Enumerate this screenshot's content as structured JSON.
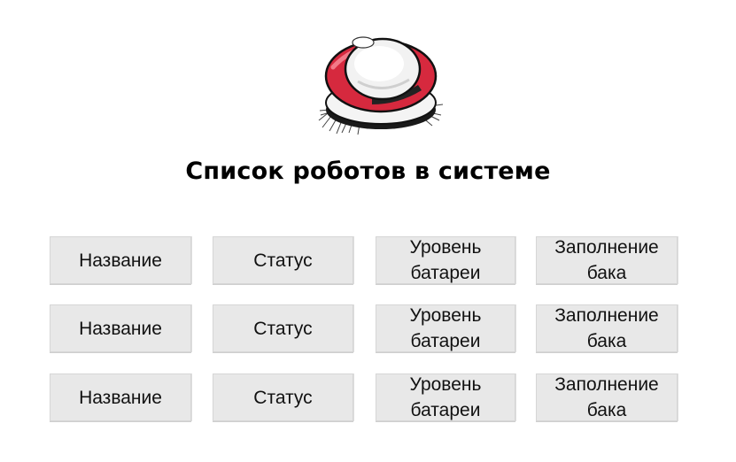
{
  "page": {
    "title": "Список роботов в системе"
  },
  "colors": {
    "cell_background": "#e8e8e8",
    "robot_accent": "#d6293e"
  },
  "logo": {
    "icon": "robot-vacuum-icon"
  },
  "robots": [
    {
      "name": "Название",
      "status": "Статус",
      "battery_line1": "Уровень",
      "battery_line2": "батареи",
      "tank_line1": "Заполнение",
      "tank_line2": "бака"
    },
    {
      "name": "Название",
      "status": "Статус",
      "battery_line1": "Уровень",
      "battery_line2": "батареи",
      "tank_line1": "Заполнение",
      "tank_line2": "бака"
    },
    {
      "name": "Название",
      "status": "Статус",
      "battery_line1": "Уровень",
      "battery_line2": "батареи",
      "tank_line1": "Заполнение",
      "tank_line2": "бака"
    }
  ]
}
